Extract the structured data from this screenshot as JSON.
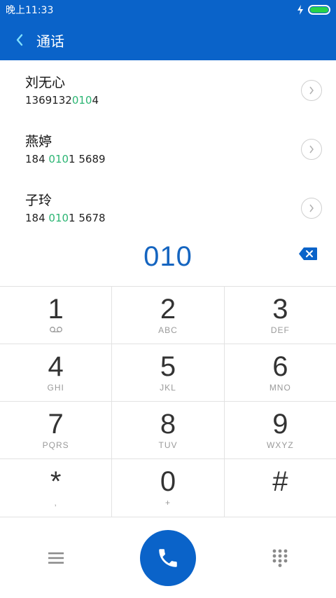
{
  "status_bar": {
    "time": "晚上11:33",
    "battery_color": "#27d24a"
  },
  "app_bar": {
    "back_icon": "back-chevron-icon",
    "title": "通话"
  },
  "contacts": [
    {
      "name": "刘无心",
      "number_pre": "1369132",
      "number_match": "010",
      "number_post": "4"
    },
    {
      "name": "燕婷",
      "number_pre": "184 ",
      "number_match": "010",
      "number_post": "1 5689"
    },
    {
      "name": "子玲",
      "number_pre": "184 ",
      "number_match": "010",
      "number_post": "1 5678"
    }
  ],
  "entry": {
    "number": "010",
    "backspace_icon": "backspace-icon"
  },
  "keypad": [
    [
      {
        "digit": "1",
        "sub": ""
      },
      {
        "digit": "2",
        "sub": "ABC"
      },
      {
        "digit": "3",
        "sub": "DEF"
      }
    ],
    [
      {
        "digit": "4",
        "sub": "GHI"
      },
      {
        "digit": "5",
        "sub": "JKL"
      },
      {
        "digit": "6",
        "sub": "MNO"
      }
    ],
    [
      {
        "digit": "7",
        "sub": "PQRS"
      },
      {
        "digit": "8",
        "sub": "TUV"
      },
      {
        "digit": "9",
        "sub": "WXYZ"
      }
    ],
    [
      {
        "digit": "*",
        "sub": ","
      },
      {
        "digit": "0",
        "sub": "+"
      },
      {
        "digit": "#",
        "sub": ""
      }
    ]
  ],
  "bottom_bar": {
    "menu_icon": "menu-icon",
    "call_icon": "phone-icon",
    "dialpad_icon": "dialpad-icon"
  },
  "colors": {
    "brand": "#0a63c9",
    "match_highlight": "#2bb573",
    "entry_text": "#1565c0"
  }
}
